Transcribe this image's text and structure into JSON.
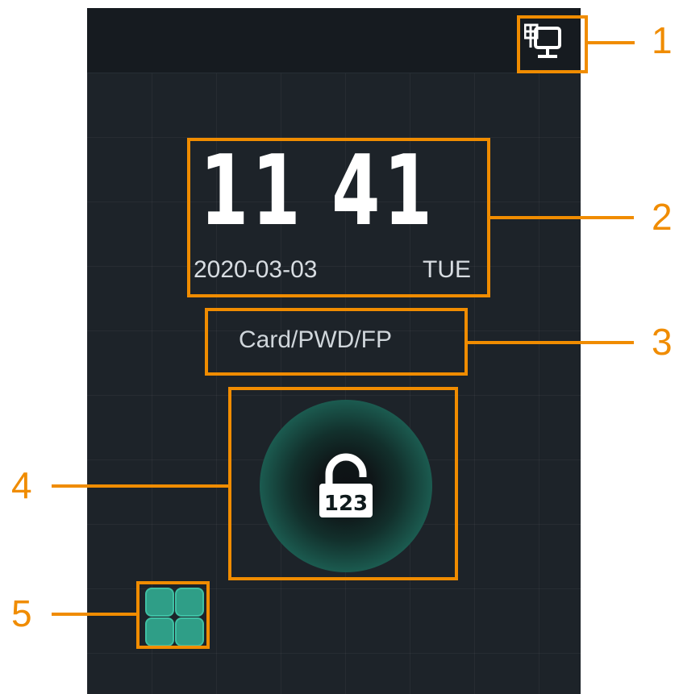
{
  "status_bar": {
    "network_icon": "network-computer-icon"
  },
  "clock": {
    "time": "11 41",
    "date": "2020-03-03",
    "weekday": "TUE"
  },
  "unlock": {
    "mode_label": "Card/PWD/FP",
    "icon": "password-lock-icon",
    "icon_text": "123"
  },
  "menu": {
    "icon": "main-menu-grid-icon"
  },
  "callouts": {
    "c1": "1",
    "c2": "2",
    "c3": "3",
    "c4": "4",
    "c5": "5"
  },
  "colors": {
    "accent": "#f08c00",
    "screen_bg": "#1d2329",
    "teal": "#2f9e87",
    "text": "#ffffff"
  }
}
